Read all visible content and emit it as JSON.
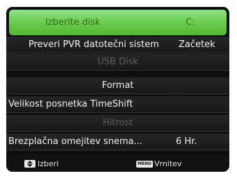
{
  "header": {
    "label": "Izberite disk",
    "value": "C:"
  },
  "menu": [
    {
      "label": "Preveri PVR datotečni sistem",
      "value": "Začetek"
    },
    {
      "label": "USB Disk",
      "value": ""
    },
    {
      "label": "Format",
      "value": ""
    },
    {
      "label": "Velikost posnetka TimeShift",
      "value": ""
    },
    {
      "label": "Hitrost",
      "value": ""
    },
    {
      "label": "Brezplačna omejitev snema...",
      "value": "6 Hr."
    }
  ],
  "footer": {
    "select_hint": "Izberi",
    "updown_icon": "up-down-arrows-icon",
    "menu_key": "MENU",
    "back_hint": "Vrnitev"
  },
  "colors": {
    "highlight": "#6fcf54",
    "highlight_text": "#2f6a14",
    "disabled_text": "#5e5e5e"
  }
}
